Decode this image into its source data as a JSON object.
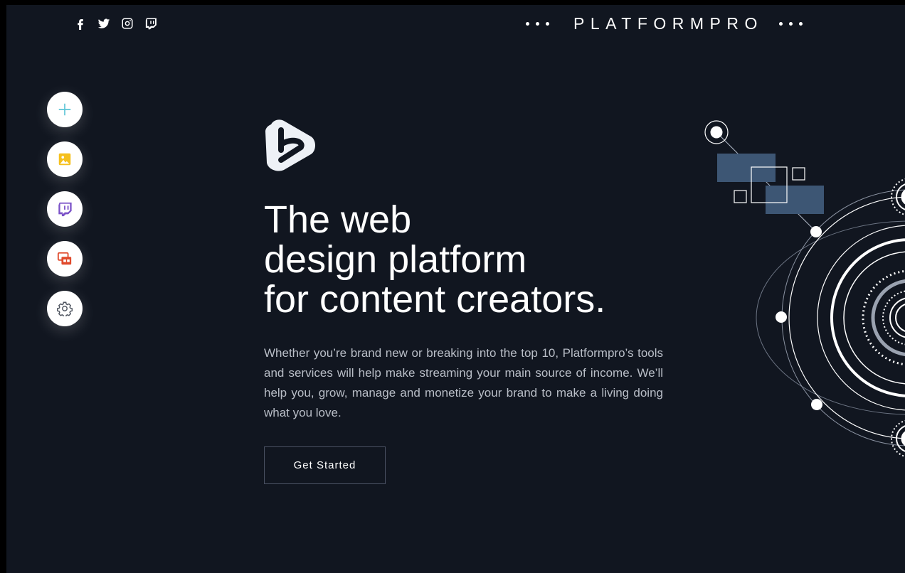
{
  "header": {
    "social": [
      {
        "name": "facebook-icon"
      },
      {
        "name": "twitter-icon"
      },
      {
        "name": "instagram-icon"
      },
      {
        "name": "twitch-icon"
      }
    ],
    "brand_name": "PLATFORMPRO"
  },
  "dock": {
    "items": [
      {
        "name": "add-icon",
        "color": "#5bc4d6"
      },
      {
        "name": "image-icon",
        "color": "#f5c01e"
      },
      {
        "name": "twitch-icon",
        "color": "#7b52c8"
      },
      {
        "name": "layout-icon",
        "color": "#e04a2c"
      },
      {
        "name": "gear-icon",
        "color": "#4f5560"
      }
    ]
  },
  "hero": {
    "headline_lines": [
      "The web",
      "design platform",
      "for content creators."
    ],
    "body": "Whether you’re brand new or breaking into the top 10, Platformpro’s tools and services will help make streaming your main source of income. We’ll help you, grow, manage and monetize your brand to make a living doing what you love.",
    "cta_label": "Get Started"
  },
  "colors": {
    "background": "#111620",
    "accent_box": "#3d5674"
  }
}
